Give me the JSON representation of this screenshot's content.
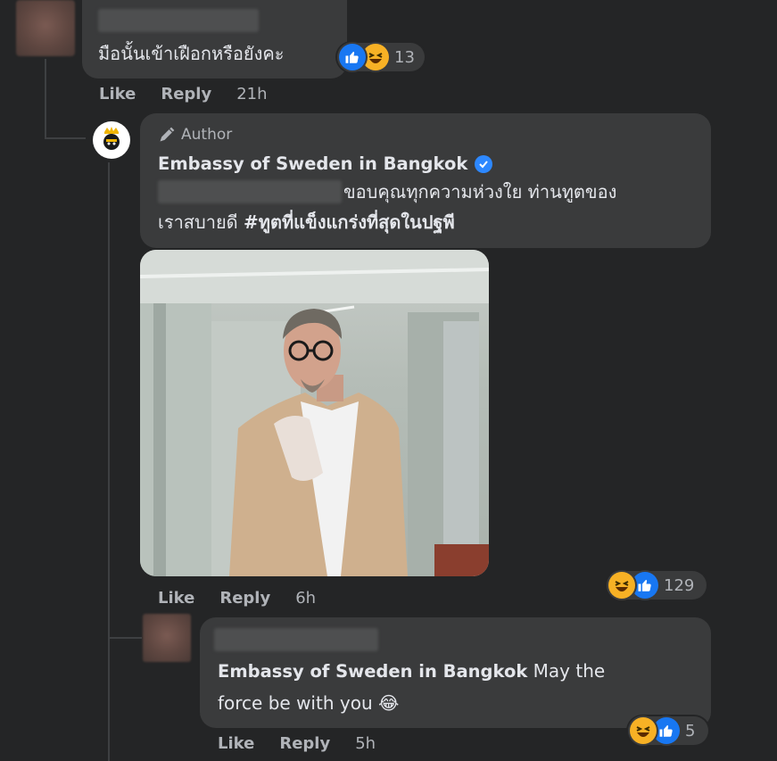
{
  "colors": {
    "background": "#242526",
    "bubble": "#3a3b3c",
    "text": "#e4e6eb",
    "muted": "#b0b3b8",
    "like_blue": "#1877f2",
    "haha_yellow": "#f7b125",
    "verified_blue": "#2d88ff"
  },
  "comment1": {
    "text": "มือนั้นเข้าเฝือกหรือยังคะ",
    "reactions": {
      "icons": [
        "like-icon",
        "haha-icon"
      ],
      "count": "13"
    },
    "actions": {
      "like": "Like",
      "reply": "Reply",
      "time": "21h"
    }
  },
  "reply1": {
    "author_badge": "Author",
    "author_badge_icon": "pencil-icon",
    "name": "Embassy of Sweden in Bangkok",
    "verified_icon": "verified-badge-icon",
    "text_line1": "ขอบคุณทุกความห่วงใย ท่านทูตของ",
    "text_line2_plain": "เราสบายดี ",
    "hashtag": "#ทูตที่แข็งแกร่งที่สุดในปฐพี",
    "reactions": {
      "icons": [
        "haha-icon",
        "like-icon"
      ],
      "count": "129"
    },
    "actions": {
      "like": "Like",
      "reply": "Reply",
      "time": "6h"
    }
  },
  "reply2": {
    "mention": "Embassy of Sweden in Bangkok",
    "text_line1": " May the",
    "text_line2": "force be with you ",
    "emoji": "😂",
    "reactions": {
      "icons": [
        "haha-icon",
        "like-icon"
      ],
      "count": "5"
    },
    "actions": {
      "like": "Like",
      "reply": "Reply",
      "time": "5h"
    }
  }
}
